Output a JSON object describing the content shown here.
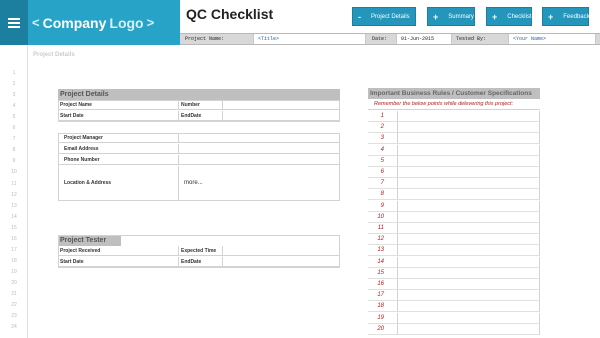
{
  "header": {
    "logo_open": "<",
    "logo_word1": "Company",
    "logo_word2": "Logo",
    "logo_close": ">",
    "title": "QC Checklist",
    "nav": [
      {
        "icon": "-",
        "label": "Project Details"
      },
      {
        "icon": "+",
        "label": "Summary"
      },
      {
        "icon": "+",
        "label": "Checklist"
      },
      {
        "icon": "+",
        "label": "Feedback"
      }
    ]
  },
  "infobar": {
    "project_name_label": "Project Name:",
    "project_name_value": "<Title>",
    "date_label": "Date:",
    "date_value": "01-Jun-2015",
    "tested_by_label": "Tested By:",
    "tested_by_value": "<Your Name>"
  },
  "breadcrumb": "Project Details",
  "row_numbers": [
    "1",
    "2",
    "3",
    "4",
    "5",
    "6",
    "7",
    "8",
    "9",
    "10",
    "11",
    "12",
    "13",
    "14",
    "15",
    "16",
    "17",
    "18",
    "19",
    "20",
    "21",
    "22",
    "23",
    "24"
  ],
  "project_details": {
    "title": "Project Details",
    "project_name": "Project Name",
    "number": "Number",
    "start_date": "Start Date",
    "end_date": "EndDate"
  },
  "contacts": {
    "project_manager": "Project Manager",
    "email": "Email Address",
    "phone": "Phone Number",
    "location": "Location & Address",
    "more": "more..."
  },
  "project_tester": {
    "title": "Project Tester",
    "project_received": "Project Received",
    "expected_time": "Expected Time",
    "start_date": "Start Date",
    "end_date": "EndDate"
  },
  "rules": {
    "title": "Important Business Rules / Customer Specifications",
    "subtitle": "Remember the below points while delevering this project:",
    "numbers": [
      "1",
      "2",
      "3",
      "4",
      "5",
      "6",
      "7",
      "8",
      "9",
      "10",
      "11",
      "12",
      "13",
      "14",
      "15",
      "16",
      "17",
      "18",
      "19",
      "20"
    ]
  },
  "colors": {
    "accent": "#27a3c7",
    "accent_dark": "#1c7fa0",
    "section_header": "#bfbfbf",
    "rule_red": "#b02020"
  }
}
